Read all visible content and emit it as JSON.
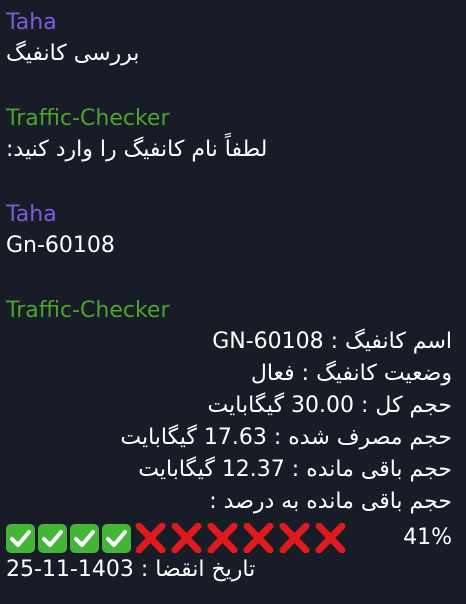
{
  "colors": {
    "background": "#181c27",
    "sender_taha": "#7b5cd9",
    "sender_bot": "#47a52a",
    "text": "#ffffff",
    "check_green": "#45b53a",
    "cross_red": "#e0191f"
  },
  "messages": [
    {
      "sender": "Taha",
      "text": "بررسی کانفیگ"
    },
    {
      "sender": "Traffic-Checker",
      "text": "لطفاً نام کانفیگ را وارد کنید:"
    },
    {
      "sender": "Taha",
      "text": "Gn-60108"
    }
  ],
  "report": {
    "sender": "Traffic-Checker",
    "config_name": "اسم کانفیگ : GN-60108",
    "config_status": "وضعیت کانفیگ : فعال",
    "total_volume": "حجم کل : 30.00  گیگابایت",
    "used_volume": "حجم مصرف شده : 17.63  گیگابایت",
    "remaining_volume": "حجم باقی مانده : 12.37  گیگابایت",
    "remaining_percent_label": "حجم باقی مانده به درصد :",
    "remaining_percent": "41%",
    "remaining_fraction": 0.41,
    "progress": {
      "filled": 4,
      "empty": 6,
      "filled_icon": "check-mark-button",
      "empty_icon": "cross-mark"
    },
    "expiry": "تاریخ انقضا : 1403-11-25"
  }
}
